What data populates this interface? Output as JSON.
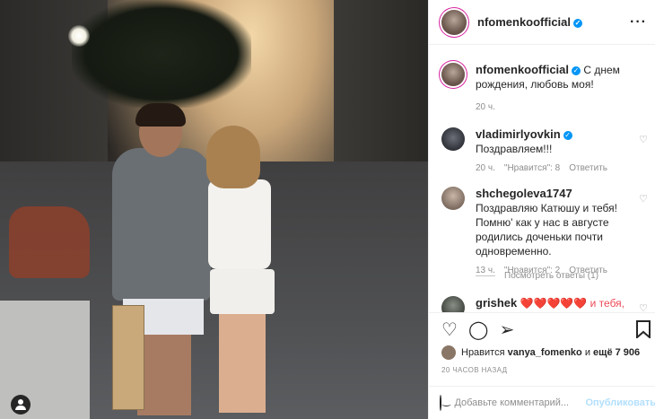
{
  "post": {
    "author": "nfomenkoofficial",
    "verified_glyph": "✓",
    "more_glyph": "···"
  },
  "caption": {
    "author": "nfomenkoofficial",
    "text": "С днем рождения, любовь моя!",
    "time": "20 ч."
  },
  "comments": [
    {
      "author": "vladimirlyovkin",
      "verified": true,
      "text": "Поздравляем!!!",
      "time": "20 ч.",
      "likes": "\"Нравится\": 8",
      "reply": "Ответить"
    },
    {
      "author": "shchegoleva1747",
      "verified": false,
      "text": "Поздравляю Катюшу и тебя! Помню' как у нас в августе родились доченьки почти одновременно.",
      "time": "13 ч.",
      "likes": "\"Нравится\": 2",
      "reply": "Ответить"
    },
    {
      "author": "grishek",
      "verified": false,
      "text": "❤️❤️❤️❤️❤️ и тебя,",
      "time": "",
      "likes": "",
      "reply": ""
    }
  ],
  "view_replies": "Посмотреть ответы (1)",
  "likes_line": {
    "prefix": "Нравится",
    "user": "vanya_fomenko",
    "mid": "и",
    "rest": "ещё 7 906"
  },
  "timestamp": "20 ЧАСОВ НАЗАД",
  "comment_box": {
    "placeholder": "Добавьте комментарий...",
    "publish": "Опубликовать"
  },
  "icons": {
    "like": "heart-icon",
    "comment": "comment-icon",
    "share": "share-icon",
    "save": "bookmark-icon",
    "emoji": "emoji-icon",
    "tag": "user-tag-icon",
    "more": "more-options-icon"
  },
  "colors": {
    "verified": "#0095f6",
    "heart_red": "#ed4956",
    "publish_disabled": "#b2dffc",
    "muted": "#8e8e8e"
  }
}
